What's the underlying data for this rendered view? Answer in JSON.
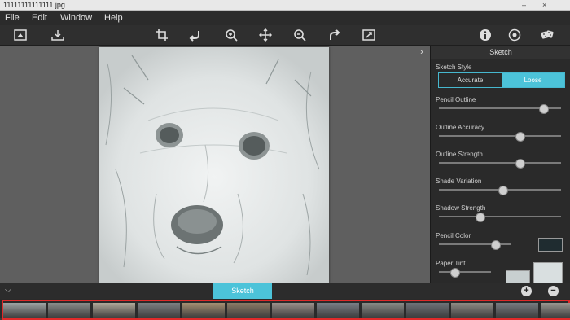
{
  "window": {
    "title": "11111111111111.jpg",
    "minimize": "–",
    "close": "×"
  },
  "menu": [
    "File",
    "Edit",
    "Window",
    "Help"
  ],
  "toolbar": {
    "left": [
      "open-image-icon",
      "save-icon"
    ],
    "center": [
      "crop-icon",
      "undo-icon",
      "zoom-in-icon",
      "move-icon",
      "zoom-out-icon",
      "redo-icon",
      "fit-screen-icon"
    ],
    "right": [
      "info-icon",
      "settings-icon",
      "dice-icon"
    ]
  },
  "panel": {
    "title": "Sketch",
    "sketch_style_label": "Sketch Style",
    "style_options": [
      "Accurate",
      "Loose"
    ],
    "selected_style": "Loose",
    "sliders": [
      {
        "label": "Pencil Outline",
        "level_percent": 85
      },
      {
        "label": "Outline Accuracy",
        "level_percent": 66
      },
      {
        "label": "Outline Strength",
        "level_percent": 66
      },
      {
        "label": "Shade Variation",
        "level_percent": 52
      },
      {
        "label": "Shadow Strength",
        "level_percent": 33
      },
      {
        "label": "Pencil Color",
        "level_percent": 78
      },
      {
        "label": "Paper Tint",
        "level_percent": 30
      }
    ],
    "pencil_color": "#1f2c30",
    "paper_tint_color": "#c8cfd0"
  },
  "bottom": {
    "tab": "Sketch",
    "add": "+",
    "remove": "−",
    "collapse": "⌵"
  },
  "colors": {
    "accent": "#4cc3d9",
    "highlight_border": "#e02a2a"
  }
}
